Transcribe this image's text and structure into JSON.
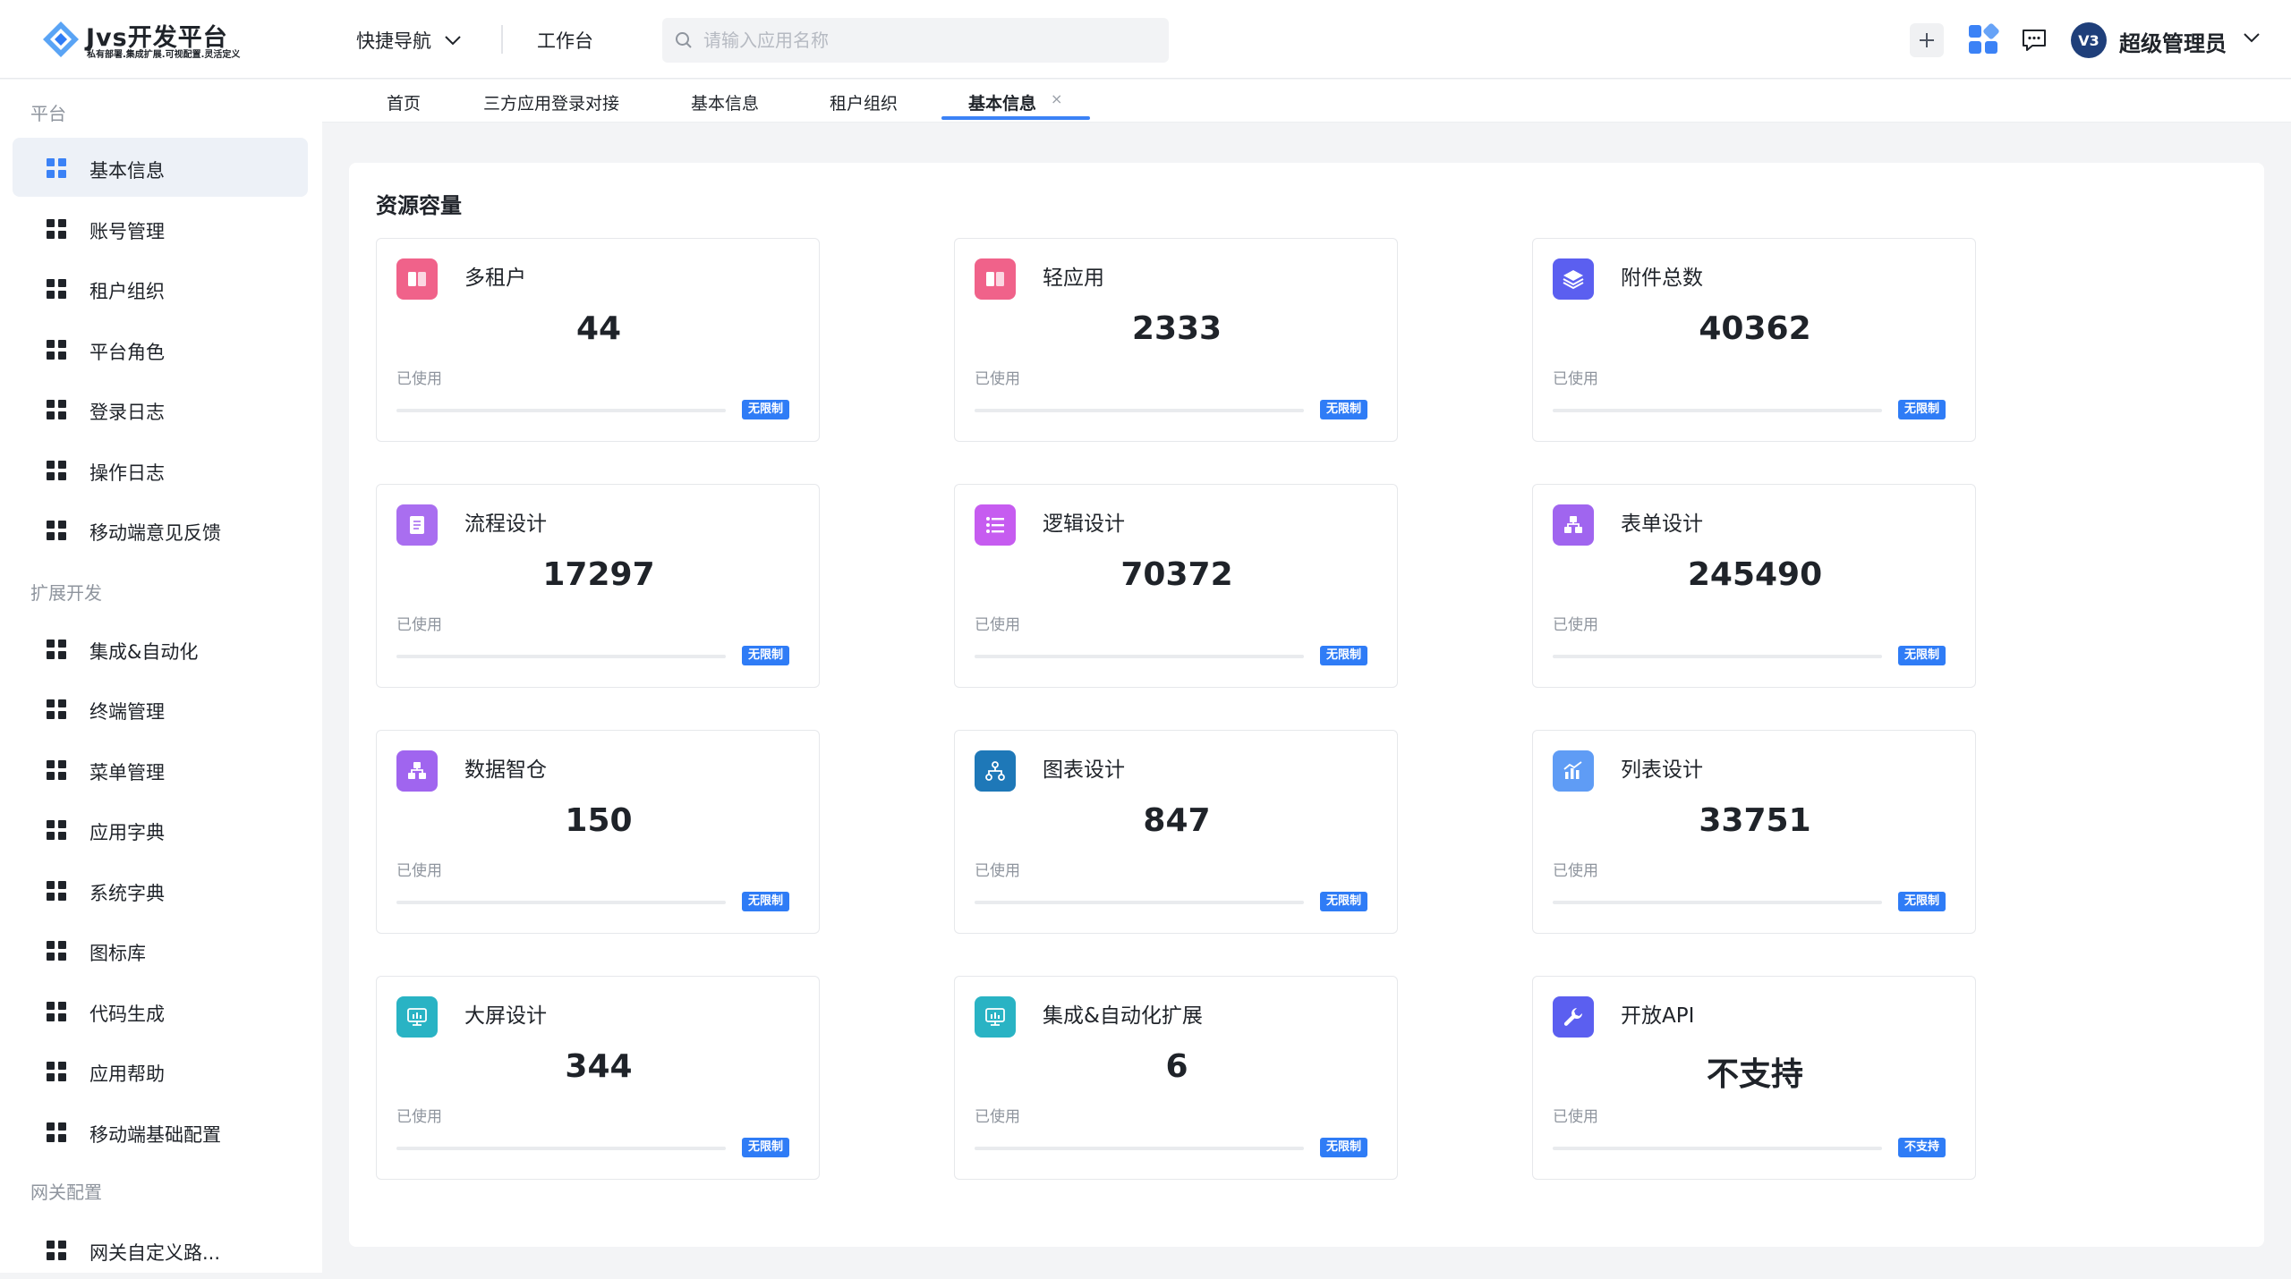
{
  "header": {
    "logo_title": "Jvs开发平台",
    "logo_subtitle": "私有部署.集成扩展.可视配置.灵活定义",
    "quick_nav_label": "快捷导航",
    "workbench_label": "工作台",
    "search_placeholder": "请输入应用名称",
    "avatar_text": "V3",
    "user_name": "超级管理员",
    "accent_color": "#3b82f6"
  },
  "sidebar": {
    "groups": [
      "平台",
      "扩展开发",
      "网关配置"
    ],
    "items": [
      {
        "label": "基本信息",
        "active": true
      },
      {
        "label": "账号管理"
      },
      {
        "label": "租户组织"
      },
      {
        "label": "平台角色"
      },
      {
        "label": "登录日志"
      },
      {
        "label": "操作日志"
      },
      {
        "label": "移动端意见反馈"
      },
      {
        "label": "集成&自动化"
      },
      {
        "label": "终端管理"
      },
      {
        "label": "菜单管理"
      },
      {
        "label": "应用字典"
      },
      {
        "label": "系统字典"
      },
      {
        "label": "图标库"
      },
      {
        "label": "代码生成"
      },
      {
        "label": "应用帮助"
      },
      {
        "label": "移动端基础配置"
      },
      {
        "label": "网关自定义路..."
      }
    ]
  },
  "tabs": [
    {
      "label": "首页"
    },
    {
      "label": "三方应用登录对接"
    },
    {
      "label": "基本信息"
    },
    {
      "label": "租户组织"
    },
    {
      "label": "基本信息",
      "active": true,
      "close": "×"
    }
  ],
  "main": {
    "section_title": "资源容量",
    "used_label": "已使用",
    "cards": [
      {
        "name": "多租户",
        "value": "44",
        "badge": "无限制",
        "usage": 0,
        "icon": "book-icon",
        "icon_color": "#f0628a"
      },
      {
        "name": "轻应用",
        "value": "2333",
        "badge": "无限制",
        "usage": 0,
        "icon": "book-icon",
        "icon_color": "#f0628a"
      },
      {
        "name": "附件总数",
        "value": "40362",
        "badge": "无限制",
        "usage": 0,
        "icon": "layers-icon",
        "icon_color": "#5b5ff0"
      },
      {
        "name": "流程设计",
        "value": "17297",
        "badge": "无限制",
        "usage": 0,
        "icon": "document-icon",
        "icon_color": "#a96ef0"
      },
      {
        "name": "逻辑设计",
        "value": "70372",
        "badge": "无限制",
        "usage": 0,
        "icon": "list-icon",
        "icon_color": "#c65cf0"
      },
      {
        "name": "表单设计",
        "value": "245490",
        "badge": "无限制",
        "usage": 0,
        "icon": "org-icon",
        "icon_color": "#a065ef"
      },
      {
        "name": "数据智仓",
        "value": "150",
        "badge": "无限制",
        "usage": 0,
        "icon": "org-icon",
        "icon_color": "#a065ef"
      },
      {
        "name": "图表设计",
        "value": "847",
        "badge": "无限制",
        "usage": 0,
        "icon": "hierarchy-icon",
        "icon_color": "#1e78b8"
      },
      {
        "name": "列表设计",
        "value": "33751",
        "badge": "无限制",
        "usage": 0,
        "icon": "chart-icon",
        "icon_color": "#5f9cf5"
      },
      {
        "name": "大屏设计",
        "value": "344",
        "badge": "无限制",
        "usage": 0,
        "icon": "screen-icon",
        "icon_color": "#29b3c4"
      },
      {
        "name": "集成&自动化扩展",
        "value": "6",
        "badge": "无限制",
        "usage": 0,
        "icon": "screen-icon",
        "icon_color": "#29b3c4"
      },
      {
        "name": "开放API",
        "value": "不支持",
        "badge": "不支持",
        "usage": 0,
        "icon": "wrench-icon",
        "icon_color": "#5b5ff0"
      }
    ]
  }
}
